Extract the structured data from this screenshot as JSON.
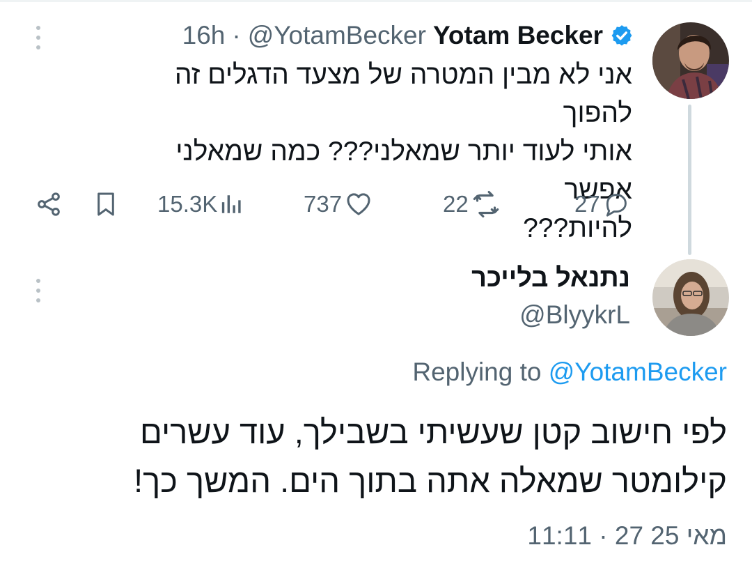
{
  "tweet": {
    "time_ago": "16h",
    "separator": "·",
    "handle": "@YotamBecker",
    "display_name": "Yotam Becker",
    "verified_icon": "verified-badge-icon",
    "text": "אני לא מבין המטרה של מצעד הדגלים זה להפוך\nאותי לעוד יותר שמאלני??? כמה שמאלני אפשר\nלהיות???",
    "views": "15.3K",
    "likes": "737",
    "retweets": "22",
    "replies": "27",
    "icons": [
      "share-icon",
      "bookmark-icon",
      "views-icon",
      "like-icon",
      "retweet-icon",
      "reply-icon",
      "more-icon"
    ]
  },
  "reply": {
    "display_name": "נתנאל בלייכר",
    "handle": "@BlyykrL",
    "replying_prefix": "Replying to",
    "replying_to": "@YotamBecker",
    "text": "לפי חישוב קטן שעשיתי בשבילך, עוד עשרים\nקילומטר שמאלה אתה בתוך הים. המשך כך!",
    "timestamp": "11:11 · 27 מאי 25"
  },
  "colors": {
    "text": "#0f1419",
    "secondary": "#536471",
    "accent": "#1d9bf0",
    "thread_line": "#cfd9de"
  }
}
